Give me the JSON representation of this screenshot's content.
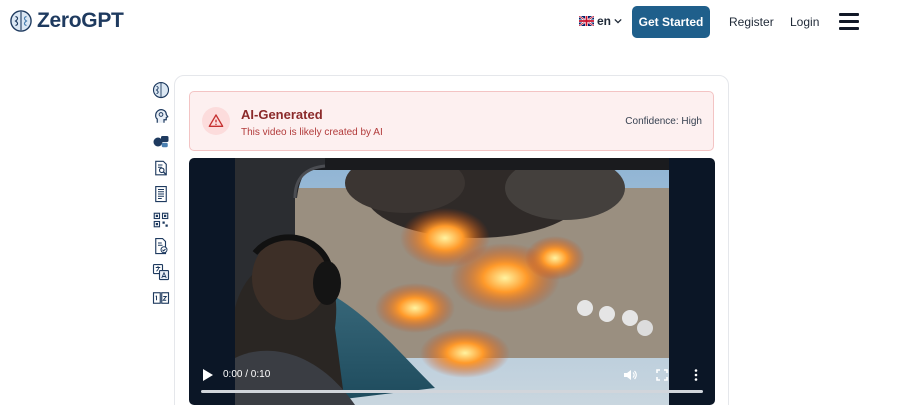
{
  "header": {
    "brand": "ZeroGPT",
    "language": "en",
    "cta_label": "Get Started",
    "register_label": "Register",
    "login_label": "Login"
  },
  "sidebar": {
    "items": [
      {
        "icon": "brain-icon"
      },
      {
        "icon": "head-icon"
      },
      {
        "icon": "ai-chat-icon"
      },
      {
        "icon": "document-search-icon"
      },
      {
        "icon": "document-icon"
      },
      {
        "icon": "qr-code-icon"
      },
      {
        "icon": "document-check-icon"
      },
      {
        "icon": "translate-icon"
      },
      {
        "icon": "word-count-icon"
      }
    ]
  },
  "result": {
    "title": "AI-Generated",
    "subtitle": "This video is likely created by AI",
    "confidence": "Confidence: High"
  },
  "video": {
    "time": "0:00 / 0:10",
    "progress": 0
  },
  "colors": {
    "brand": "#1e3a5f",
    "cta": "#1f5f8b",
    "alert_bg": "#fdf0f0",
    "alert_title": "#8b2a2a"
  }
}
